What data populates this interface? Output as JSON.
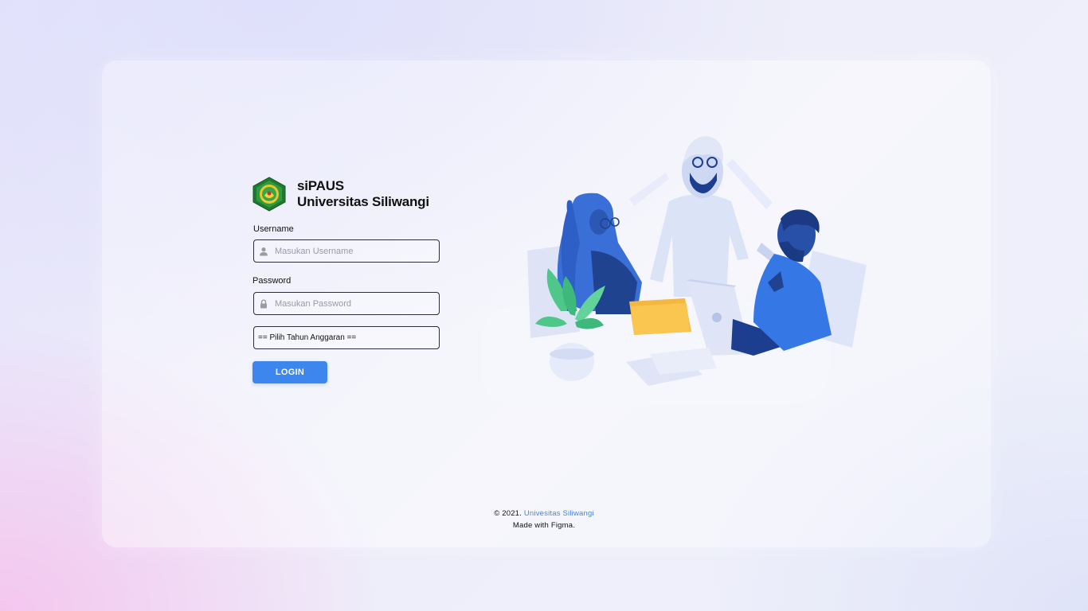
{
  "brand": {
    "app_name": "siPAUS",
    "university": "Universitas Siliwangi",
    "logo_icon": "university-crest-icon"
  },
  "form": {
    "username_label": "Username",
    "username_placeholder": "Masukan Username",
    "username_icon": "user-icon",
    "password_label": "Password",
    "password_placeholder": "Masukan Password",
    "password_icon": "lock-icon",
    "year_select_value": "== Pilih Tahun Anggaran ==",
    "login_label": "LOGIN"
  },
  "footer": {
    "copyright": "© 2021.",
    "link_text": "Univesitas Siliwangi",
    "made_with": "Made with Figma."
  },
  "colors": {
    "accent": "#3d86ee",
    "border": "#2c2c3a"
  },
  "illustration": {
    "icon": "team-meeting-illustration"
  }
}
